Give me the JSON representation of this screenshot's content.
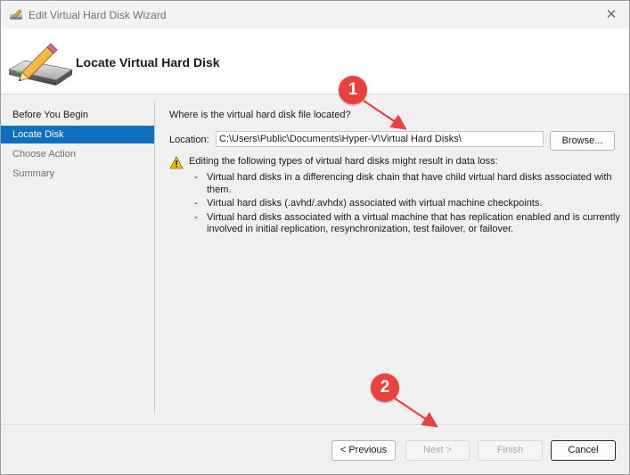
{
  "window": {
    "title": "Edit Virtual Hard Disk Wizard",
    "close_glyph": "✕"
  },
  "header": {
    "title": "Locate Virtual Hard Disk",
    "icon": "disk-with-pencil-icon"
  },
  "nav": {
    "items": [
      {
        "label": "Before You Begin",
        "state": "normal"
      },
      {
        "label": "Locate Disk",
        "state": "selected"
      },
      {
        "label": "Choose Action",
        "state": "dim"
      },
      {
        "label": "Summary",
        "state": "dim"
      }
    ]
  },
  "content": {
    "question": "Where is the virtual hard disk file located?",
    "location_label": "Location:",
    "location_value": "C:\\Users\\Public\\Documents\\Hyper-V\\Virtual Hard Disks\\",
    "browse_label": "Browse...",
    "warning_icon": "warning-triangle-icon",
    "warning_text": "Editing the following types of virtual hard disks might result in data loss:",
    "bullets": [
      {
        "dash": "-",
        "text": "Virtual hard disks in a differencing disk chain that have child virtual hard disks associated with them."
      },
      {
        "dash": "-",
        "text": "Virtual hard disks (.avhd/.avhdx) associated with virtual machine checkpoints."
      },
      {
        "dash": "-",
        "text": "Virtual hard disks associated with a virtual machine that has replication enabled and is currently involved in initial replication, resynchronization, test failover, or failover."
      }
    ]
  },
  "footer": {
    "previous": "< Previous",
    "next": "Next >",
    "finish": "Finish",
    "cancel": "Cancel"
  },
  "annotations": {
    "callout_1": "1",
    "callout_2": "2",
    "color": "#e8413e"
  },
  "colors": {
    "selection": "#0e6fbe",
    "window_bg": "#f0f0f0"
  }
}
